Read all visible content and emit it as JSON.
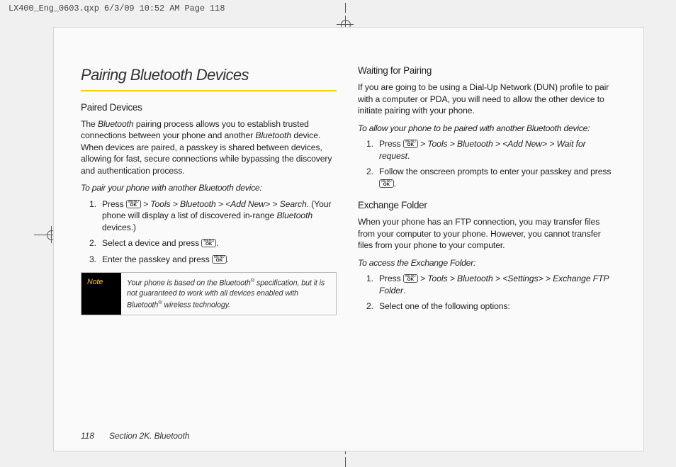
{
  "doc_header": "LX400_Eng_0603.qxp  6/3/09  10:52 AM  Page 118",
  "left": {
    "title": "Pairing Bluetooth Devices",
    "h2_1": "Paired Devices",
    "p1a": "The ",
    "p1b": "Bluetooth",
    "p1c": " pairing process allows you to establish trusted connections between your phone and another ",
    "p1d": "Bluetooth",
    "p1e": " device. When devices are paired, a passkey is shared between devices, allowing for fast, secure connections while bypassing the discovery and authentication process.",
    "instr1": "To pair your phone with another Bluetooth device:",
    "li1a": "Press ",
    "li1b": " > Tools > Bluetooth > <Add New> > Search",
    "li1c": ". (Your phone will display a list of discovered in-range ",
    "li1d": "Bluetooth",
    "li1e": " devices.)",
    "li2a": "Select a device and press ",
    "li3a": "Enter the passkey and press ",
    "note_label": "Note",
    "note_text_a": "Your phone is based on the Bluetooth",
    "note_text_b": " specification, but it is not guaranteed to work with all devices enabled with Bluetooth",
    "note_text_c": " wireless technology."
  },
  "right": {
    "h2_1": "Waiting for Pairing",
    "p1": "If you are going to be using a Dial-Up Network (DUN) profile to pair with a computer or PDA, you will need to allow the other device to initiate pairing with your phone.",
    "instr1": "To allow your phone to be paired with another Bluetooth device:",
    "li1a": "Press ",
    "li1b": " > Tools > Bluetooth > <Add New> > Wait for request",
    "li2a": "Follow the onscreen prompts to enter your passkey and press ",
    "h2_2": "Exchange Folder",
    "p2": "When your phone has an FTP connection, you may transfer files from your computer to your phone. However, you cannot transfer files from your phone to your computer.",
    "instr2": "To access the Exchange Folder:",
    "li3a": "Press ",
    "li3b": " > Tools > Bluetooth > <Settings> > Exchange FTP Folder",
    "li4a": "Select one of the following options:"
  },
  "footer": {
    "page": "118",
    "section": "Section 2K. Bluetooth"
  }
}
